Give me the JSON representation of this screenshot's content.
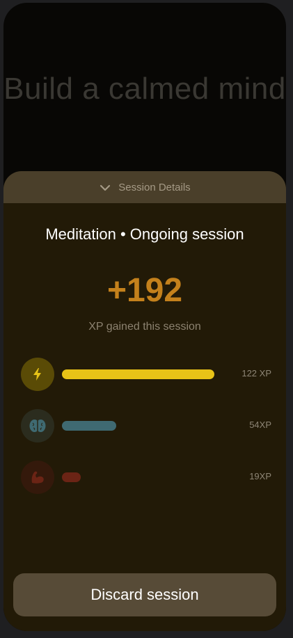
{
  "background": {
    "title": "Build a calmed mind"
  },
  "sheet": {
    "header_label": "Session Details",
    "session_title": "Meditation • Ongoing session",
    "xp_total": "+192",
    "xp_caption": "XP gained this session",
    "stats": [
      {
        "icon": "lightning-icon",
        "value_label": "122 XP",
        "xp": 122,
        "color": "#e8c317",
        "icon_bg": "#5a4b06"
      },
      {
        "icon": "brain-icon",
        "value_label": "54XP",
        "xp": 54,
        "color": "#3f6a72",
        "icon_bg": "#2b2c1e"
      },
      {
        "icon": "muscle-icon",
        "value_label": "19XP",
        "xp": 19,
        "color": "#6b2415",
        "icon_bg": "#34190b"
      }
    ],
    "discard_label": "Discard session"
  },
  "colors": {
    "accent_xp": "#c4811c",
    "sheet_bg": "#221a07",
    "header_bg": "#4a3f2a",
    "button_bg": "#574b37"
  }
}
